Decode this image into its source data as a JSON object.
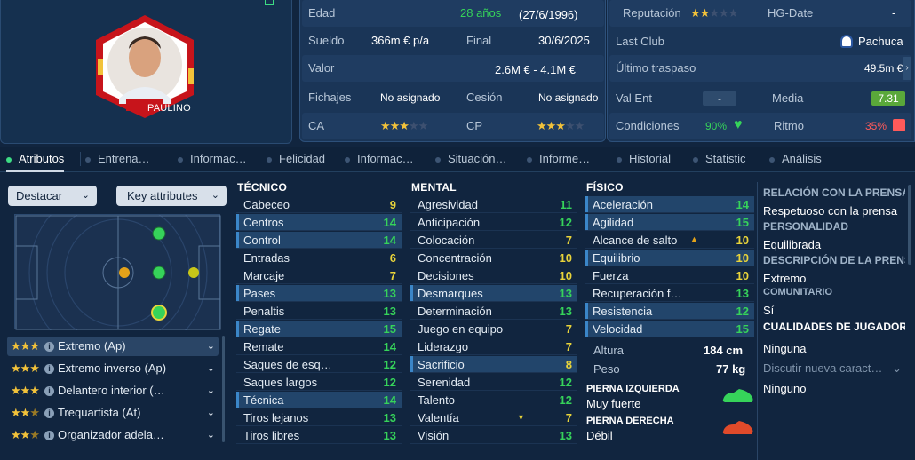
{
  "player": {
    "name_tag": "PAULINO",
    "age_label": "Edad",
    "age_value": "28 años",
    "dob": "(27/6/1996)",
    "salary_label": "Sueldo",
    "salary_value": "366m € p/a",
    "contract_end_label": "Final",
    "contract_end_value": "30/6/2025",
    "value_label": "Valor",
    "value_value": "2.6M € - 4.1M €",
    "signings_label": "Fichajes",
    "signings_value": "No asignado",
    "loan_label": "Cesión",
    "loan_value": "No asignado",
    "ca_label": "CA",
    "cp_label": "CP",
    "ca_stars": 3,
    "cp_stars": 3,
    "reputation_label": "Reputación",
    "reputation_stars": 2,
    "hg_label": "HG-Date",
    "hg_value": "-",
    "last_club_label": "Last Club",
    "last_club_value": "Pachuca",
    "last_transfer_label": "Último traspaso",
    "last_transfer_value": "49.5m €",
    "val_ent_label": "Val Ent",
    "val_ent_value": "-",
    "media_label": "Media",
    "media_value": "7.31",
    "conditions_label": "Condiciones",
    "conditions_value": "90%",
    "rhythm_label": "Ritmo",
    "rhythm_value": "35%"
  },
  "tabs": [
    "Atributos",
    "Entrena…",
    "Informac…",
    "Felicidad",
    "Informac…",
    "Situación…",
    "Informe…",
    "Historial",
    "Statistic",
    "Análisis"
  ],
  "controls": {
    "highlight": "Destacar",
    "key_attributes": "Key attributes"
  },
  "roles": [
    {
      "stars": 3,
      "label": "Extremo (Ap)"
    },
    {
      "stars": 3,
      "label": "Extremo inverso (Ap)"
    },
    {
      "stars": 3,
      "label": "Delantero interior (…"
    },
    {
      "stars": 2.5,
      "label": "Trequartista (At)"
    },
    {
      "stars": 2.5,
      "label": "Organizador adela…"
    }
  ],
  "technical": {
    "title": "TÉCNICO",
    "rows": [
      {
        "name": "Cabeceo",
        "value": "9",
        "color": "#e9d43a",
        "hl": false
      },
      {
        "name": "Centros",
        "value": "14",
        "color": "#36d35a",
        "hl": true
      },
      {
        "name": "Control",
        "value": "14",
        "color": "#36d35a",
        "hl": true
      },
      {
        "name": "Entradas",
        "value": "6",
        "color": "#e9d43a",
        "hl": false
      },
      {
        "name": "Marcaje",
        "value": "7",
        "color": "#e9d43a",
        "hl": false
      },
      {
        "name": "Pases",
        "value": "13",
        "color": "#36d35a",
        "hl": true
      },
      {
        "name": "Penaltis",
        "value": "13",
        "color": "#36d35a",
        "hl": false
      },
      {
        "name": "Regate",
        "value": "15",
        "color": "#36d35a",
        "hl": true
      },
      {
        "name": "Remate",
        "value": "14",
        "color": "#36d35a",
        "hl": false
      },
      {
        "name": "Saques de esq…",
        "value": "12",
        "color": "#36d35a",
        "hl": false
      },
      {
        "name": "Saques largos",
        "value": "12",
        "color": "#36d35a",
        "hl": false
      },
      {
        "name": "Técnica",
        "value": "14",
        "color": "#36d35a",
        "hl": true
      },
      {
        "name": "Tiros lejanos",
        "value": "13",
        "color": "#36d35a",
        "hl": false
      },
      {
        "name": "Tiros libres",
        "value": "13",
        "color": "#36d35a",
        "hl": false
      }
    ]
  },
  "mental": {
    "title": "MENTAL",
    "rows": [
      {
        "name": "Agresividad",
        "value": "11",
        "color": "#36d35a",
        "hl": false
      },
      {
        "name": "Anticipación",
        "value": "12",
        "color": "#36d35a",
        "hl": false
      },
      {
        "name": "Colocación",
        "value": "7",
        "color": "#e9d43a",
        "hl": false
      },
      {
        "name": "Concentración",
        "value": "10",
        "color": "#e9d43a",
        "hl": false
      },
      {
        "name": "Decisiones",
        "value": "10",
        "color": "#e9d43a",
        "hl": false
      },
      {
        "name": "Desmarques",
        "value": "13",
        "color": "#36d35a",
        "hl": true
      },
      {
        "name": "Determinación",
        "value": "13",
        "color": "#36d35a",
        "hl": false
      },
      {
        "name": "Juego en equipo",
        "value": "7",
        "color": "#e9d43a",
        "hl": false
      },
      {
        "name": "Liderazgo",
        "value": "7",
        "color": "#e9d43a",
        "hl": false
      },
      {
        "name": "Sacrificio",
        "value": "8",
        "color": "#e9d43a",
        "hl": true
      },
      {
        "name": "Serenidad",
        "value": "12",
        "color": "#36d35a",
        "hl": false
      },
      {
        "name": "Talento",
        "value": "12",
        "color": "#36d35a",
        "hl": false
      },
      {
        "name": "Valentía",
        "value": "7",
        "color": "#e9d43a",
        "hl": false
      },
      {
        "name": "Visión",
        "value": "13",
        "color": "#36d35a",
        "hl": false
      }
    ]
  },
  "physical": {
    "title": "FÍSICO",
    "rows": [
      {
        "name": "Aceleración",
        "value": "14",
        "color": "#36d35a",
        "hl": true
      },
      {
        "name": "Agilidad",
        "value": "15",
        "color": "#36d35a",
        "hl": true
      },
      {
        "name": "Alcance de salto",
        "value": "10",
        "color": "#e9d43a",
        "hl": false
      },
      {
        "name": "Equilibrio",
        "value": "10",
        "color": "#e9d43a",
        "hl": true
      },
      {
        "name": "Fuerza",
        "value": "10",
        "color": "#e9d43a",
        "hl": false
      },
      {
        "name": "Recuperación f…",
        "value": "13",
        "color": "#36d35a",
        "hl": false
      },
      {
        "name": "Resistencia",
        "value": "12",
        "color": "#36d35a",
        "hl": true
      },
      {
        "name": "Velocidad",
        "value": "15",
        "color": "#36d35a",
        "hl": true
      }
    ],
    "height_label": "Altura",
    "height_value": "184 cm",
    "weight_label": "Peso",
    "weight_value": "77 kg",
    "left_foot_label": "PIERNA IZQUIERDA",
    "left_foot_value": "Muy fuerte",
    "right_foot_label": "PIERNA DERECHA",
    "right_foot_value": "Débil"
  },
  "sidebar": {
    "press_h": "RELACIÓN CON LA PRENSA",
    "press_v": "Respetuoso con la prensa",
    "personality_h": "PERSONALIDAD",
    "personality_v": "Equilibrada",
    "desc_h": "DESCRIPCIÓN DE LA PRENSA",
    "desc_v": "Extremo",
    "community_h": "COMUNITARIO",
    "community_v": "Sí",
    "traits_h": "CUALIDADES DE JUGADOR",
    "traits_v": "Ninguna",
    "discuss": "Discutir nueva caract…",
    "discuss_v": "Ninguno"
  },
  "colors": {
    "green": "#36d35a",
    "yellow": "#e9d43a",
    "star": "#f2c23a",
    "media_bg": "#5aa83a",
    "rhythm": "#ff5a5a"
  }
}
